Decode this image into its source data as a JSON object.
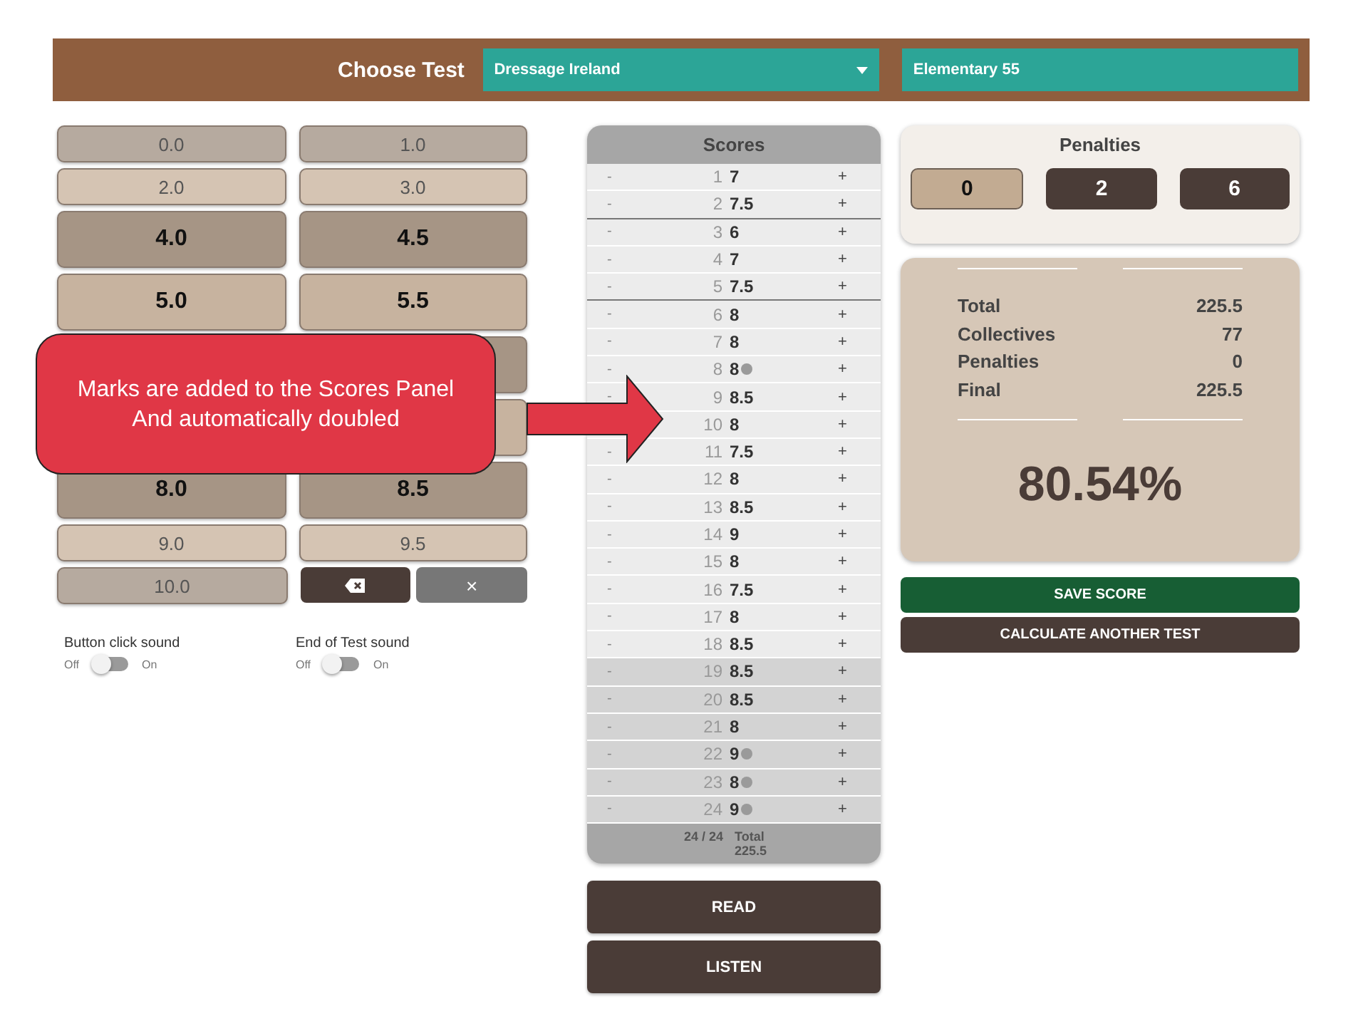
{
  "header": {
    "label": "Choose Test",
    "organisation": {
      "value": "Dressage Ireland"
    },
    "test": {
      "value": "Elementary 55"
    }
  },
  "mark_rows": [
    {
      "kind": "minor",
      "buttons": [
        {
          "label": "0.0"
        },
        {
          "label": "1.0"
        }
      ]
    },
    {
      "kind": "minor",
      "buttons": [
        {
          "label": "2.0"
        },
        {
          "label": "3.0"
        }
      ]
    },
    {
      "kind": "major",
      "buttons": [
        {
          "label": "4.0"
        },
        {
          "label": "4.5"
        }
      ]
    },
    {
      "kind": "major",
      "buttons": [
        {
          "label": "5.0"
        },
        {
          "label": "5.5"
        }
      ]
    },
    {
      "kind": "major",
      "covered": true
    },
    {
      "kind": "major",
      "covered": true
    },
    {
      "kind": "major",
      "buttons": [
        {
          "label": "8.0"
        },
        {
          "label": "8.5"
        }
      ]
    },
    {
      "kind": "minor",
      "buttons": [
        {
          "label": "9.0"
        },
        {
          "label": "9.5"
        }
      ]
    }
  ],
  "last_row": {
    "mark": "10.0",
    "clear": "×"
  },
  "toggles": [
    {
      "label": "Button click sound",
      "off": "Off",
      "on_label": "On",
      "on": false
    },
    {
      "label": "End of Test sound",
      "off": "Off",
      "on_label": "On",
      "on": false
    }
  ],
  "scores": {
    "title": "Scores",
    "rows": [
      {
        "minus": "-",
        "number": "1",
        "score": "7",
        "plus": "+",
        "note": false,
        "kind": "movement",
        "divider_after": false
      },
      {
        "minus": "-",
        "number": "2",
        "score": "7.5",
        "plus": "+",
        "note": false,
        "kind": "movement",
        "divider_after": true
      },
      {
        "minus": "-",
        "number": "3",
        "score": "6",
        "plus": "+",
        "note": false,
        "kind": "movement",
        "divider_after": false
      },
      {
        "minus": "-",
        "number": "4",
        "score": "7",
        "plus": "+",
        "note": false,
        "kind": "movement",
        "divider_after": false
      },
      {
        "minus": "-",
        "number": "5",
        "score": "7.5",
        "plus": "+",
        "note": false,
        "kind": "movement",
        "divider_after": true
      },
      {
        "minus": "-",
        "number": "6",
        "score": "8",
        "plus": "+",
        "note": false,
        "kind": "movement",
        "divider_after": false
      },
      {
        "minus": "-",
        "number": "7",
        "score": "8",
        "plus": "+",
        "note": false,
        "kind": "movement",
        "divider_after": false
      },
      {
        "minus": "-",
        "number": "8",
        "score": "8",
        "plus": "+",
        "note": true,
        "kind": "movement",
        "divider_after": false
      },
      {
        "minus": "-",
        "number": "9",
        "score": "8.5",
        "plus": "+",
        "note": false,
        "kind": "movement",
        "divider_after": false
      },
      {
        "number": "10",
        "score": "8",
        "plus": "+",
        "note": false,
        "kind": "movement",
        "divider_after": false
      },
      {
        "minus": "-",
        "number": "11",
        "score": "7.5",
        "plus": "+",
        "note": false,
        "kind": "movement",
        "divider_after": false
      },
      {
        "minus": "-",
        "number": "12",
        "score": "8",
        "plus": "+",
        "note": false,
        "kind": "movement",
        "divider_after": false
      },
      {
        "minus": "-",
        "number": "13",
        "score": "8.5",
        "plus": "+",
        "note": false,
        "kind": "movement",
        "divider_after": false
      },
      {
        "minus": "-",
        "number": "14",
        "score": "9",
        "plus": "+",
        "note": false,
        "kind": "movement",
        "divider_after": false
      },
      {
        "minus": "-",
        "number": "15",
        "score": "8",
        "plus": "+",
        "note": false,
        "kind": "movement",
        "divider_after": false
      },
      {
        "minus": "-",
        "number": "16",
        "score": "7.5",
        "plus": "+",
        "note": false,
        "kind": "movement",
        "divider_after": false
      },
      {
        "minus": "-",
        "number": "17",
        "score": "8",
        "plus": "+",
        "note": false,
        "kind": "movement",
        "divider_after": false
      },
      {
        "minus": "-",
        "number": "18",
        "score": "8.5",
        "plus": "+",
        "note": false,
        "kind": "movement",
        "divider_after": false
      },
      {
        "minus": "-",
        "number": "19",
        "score": "8.5",
        "plus": "+",
        "note": false,
        "kind": "collective",
        "divider_after": false
      },
      {
        "minus": "-",
        "number": "20",
        "score": "8.5",
        "plus": "+",
        "note": false,
        "kind": "collective",
        "divider_after": false
      },
      {
        "minus": "-",
        "number": "21",
        "score": "8",
        "plus": "+",
        "note": false,
        "kind": "collective",
        "divider_after": false
      },
      {
        "minus": "-",
        "number": "22",
        "score": "9",
        "plus": "+",
        "note": true,
        "kind": "collective",
        "divider_after": false
      },
      {
        "minus": "-",
        "number": "23",
        "score": "8",
        "plus": "+",
        "note": true,
        "kind": "collective",
        "divider_after": false
      },
      {
        "minus": "-",
        "number": "24",
        "score": "9",
        "plus": "+",
        "note": true,
        "kind": "collective",
        "divider_after": false
      }
    ],
    "count": "24 / 24",
    "total_label": "Total",
    "total": "225.5"
  },
  "actions": [
    "READ",
    "LISTEN"
  ],
  "penalties": {
    "title": "Penalties",
    "options": [
      {
        "label": "0",
        "selected": true
      },
      {
        "label": "2",
        "selected": false
      },
      {
        "label": "6",
        "selected": false
      }
    ]
  },
  "summary": {
    "lines": [
      {
        "label": "Total",
        "value": "225.5"
      },
      {
        "label": "Collectives",
        "value": "77"
      },
      {
        "label": "Penalties",
        "value": "0"
      },
      {
        "label": "Final",
        "value": "225.5"
      }
    ],
    "percentage": "80.54%"
  },
  "buttons": [
    {
      "label": "SAVE SCORE",
      "kind": "primary"
    },
    {
      "label": "CALCULATE ANOTHER TEST",
      "kind": "secondary"
    }
  ],
  "callout": {
    "lines": [
      "Marks are added to the Scores Panel",
      "And automatically doubled"
    ]
  }
}
